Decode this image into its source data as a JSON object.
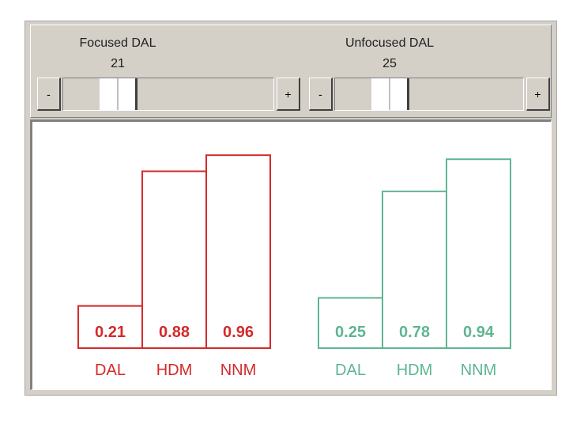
{
  "sliders": [
    {
      "title": "Focused DAL",
      "value": "21",
      "minus_label": "-",
      "plus_label": "+",
      "level": 0.21
    },
    {
      "title": "Unfocused DAL",
      "value": "25",
      "minus_label": "-",
      "plus_label": "+",
      "level": 0.25
    }
  ],
  "chart_data": [
    {
      "type": "bar",
      "categories": [
        "DAL",
        "HDM",
        "NNM"
      ],
      "values": [
        0.21,
        0.88,
        0.96
      ],
      "value_labels": [
        "0.21",
        "0.88",
        "0.96"
      ],
      "color": "#d42a2a",
      "ylim": [
        0,
        1
      ]
    },
    {
      "type": "bar",
      "categories": [
        "DAL",
        "HDM",
        "NNM"
      ],
      "values": [
        0.25,
        0.78,
        0.94
      ],
      "value_labels": [
        "0.25",
        "0.78",
        "0.94"
      ],
      "color": "#5fb592",
      "ylim": [
        0,
        1
      ]
    }
  ]
}
